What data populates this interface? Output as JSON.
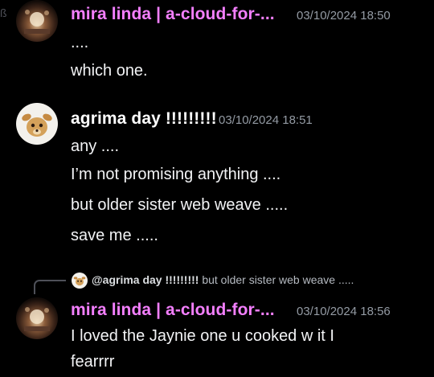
{
  "colors": {
    "background": "#000000",
    "username_mira": "#f47fff",
    "username_agrima": "#ffffff",
    "timestamp": "#949ba4",
    "message_text": "#f2f3f5"
  },
  "messages": [
    {
      "author": "mira linda | a-cloud-for-...",
      "timestamp": "03/10/2024 18:50",
      "avatar_icon": "fireplace-avatar-icon",
      "lines": [
        "....",
        "which one."
      ]
    },
    {
      "author": "agrima day !!!!!!!!!",
      "timestamp": "03/10/2024 18:51",
      "avatar_icon": "cartoon-deer-avatar-icon",
      "lines": [
        "any ....",
        "I’m not promising anything ....",
        "but older sister web weave .....",
        "save me ....."
      ]
    },
    {
      "reply_to": {
        "author": "@agrima day !!!!!!!!!",
        "snippet": "but older sister web weave .....",
        "avatar_icon": "cartoon-deer-avatar-icon"
      },
      "author": "mira linda | a-cloud-for-...",
      "timestamp": "03/10/2024 18:56",
      "avatar_icon": "fireplace-avatar-icon",
      "lines": [
        "I loved the Jaynie one u cooked w it I",
        "fearrrr"
      ]
    }
  ]
}
